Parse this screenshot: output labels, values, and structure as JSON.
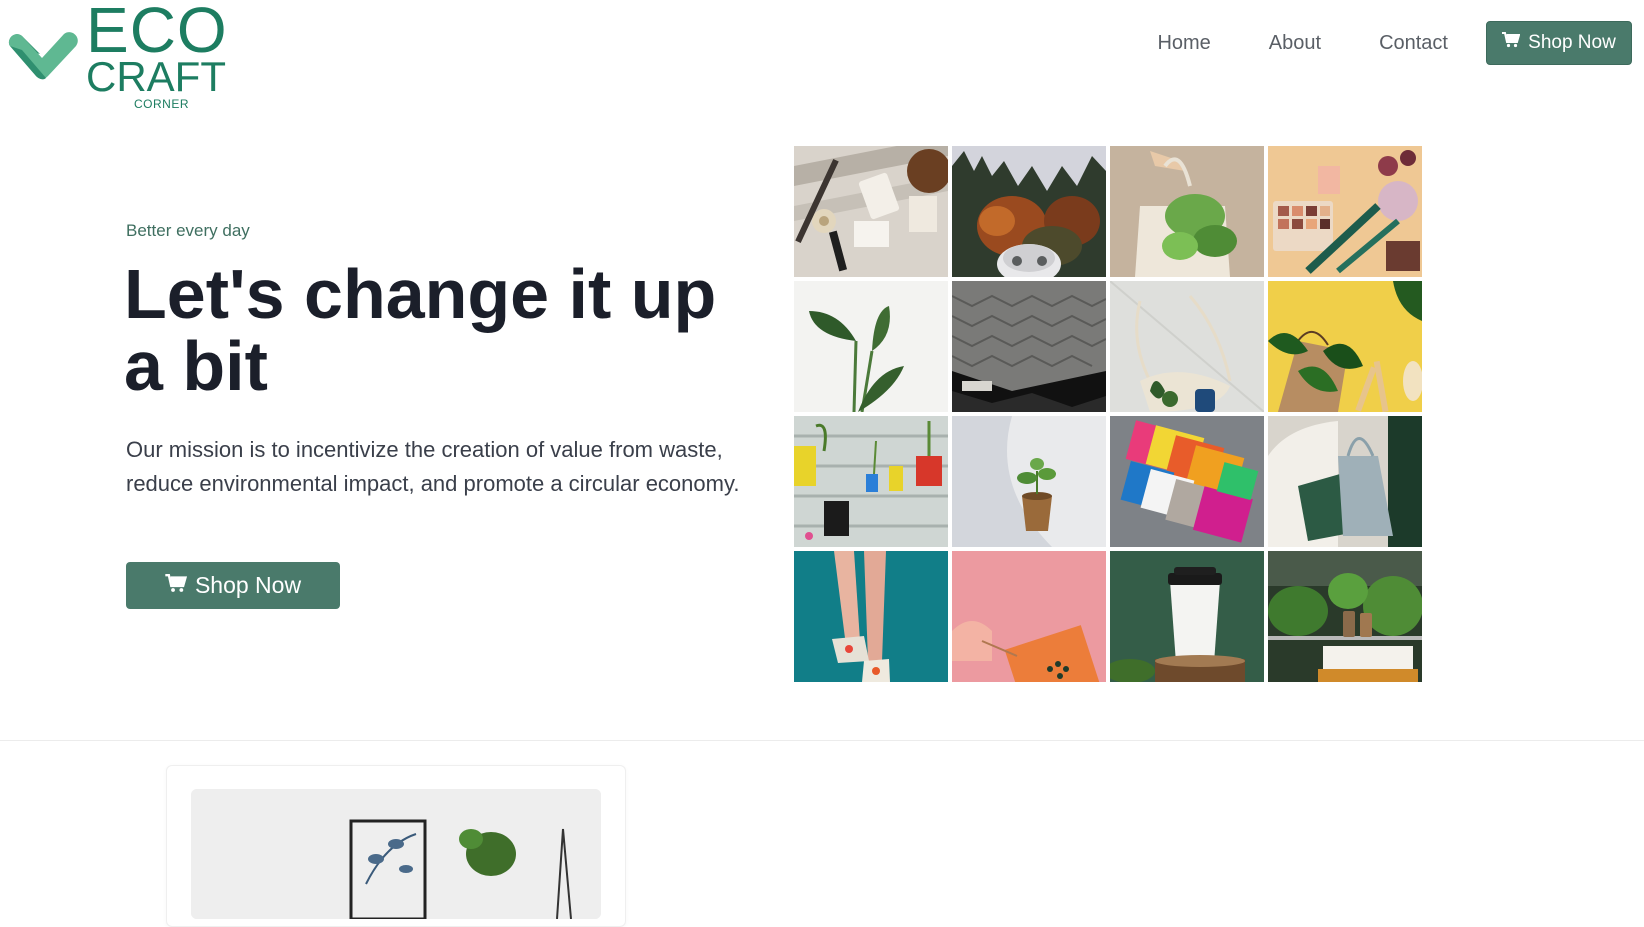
{
  "brand": {
    "line1": "ECO",
    "line2": "CRAFT",
    "line3": "CORNER",
    "color": "#1d7d61",
    "mark_colors": [
      "#2f8f6f",
      "#5fb892"
    ]
  },
  "nav": {
    "items": [
      {
        "label": "Home"
      },
      {
        "label": "About"
      },
      {
        "label": "Contact"
      }
    ],
    "cta_label": "Shop Now",
    "cta_icon": "cart-icon"
  },
  "hero": {
    "tagline": "Better every day",
    "title": "Let's change it up a bit",
    "description": "Our mission is to incentivize the creation of value from waste, reduce environmental impact, and promote a circular economy.",
    "cta_label": "Shop Now",
    "cta_icon": "cart-icon",
    "accent_color": "#4a7a6b"
  },
  "gallery": {
    "tiles": [
      {
        "name": "bath-accessories-photo"
      },
      {
        "name": "autumn-trees-photo"
      },
      {
        "name": "tote-bag-plant-photo"
      },
      {
        "name": "makeup-palette-photo"
      },
      {
        "name": "green-plant-leaves-photo"
      },
      {
        "name": "knit-blanket-photo"
      },
      {
        "name": "mesh-shopping-bag-photo"
      },
      {
        "name": "paper-bag-cutlery-photo"
      },
      {
        "name": "hanging-can-planters-photo"
      },
      {
        "name": "seedling-pot-photo"
      },
      {
        "name": "colorful-bags-photo"
      },
      {
        "name": "denim-tote-chair-photo"
      },
      {
        "name": "sneakers-walking-photo"
      },
      {
        "name": "orange-box-pink-photo"
      },
      {
        "name": "coffee-cup-stump-photo"
      },
      {
        "name": "greenhouse-plants-photo"
      }
    ]
  }
}
